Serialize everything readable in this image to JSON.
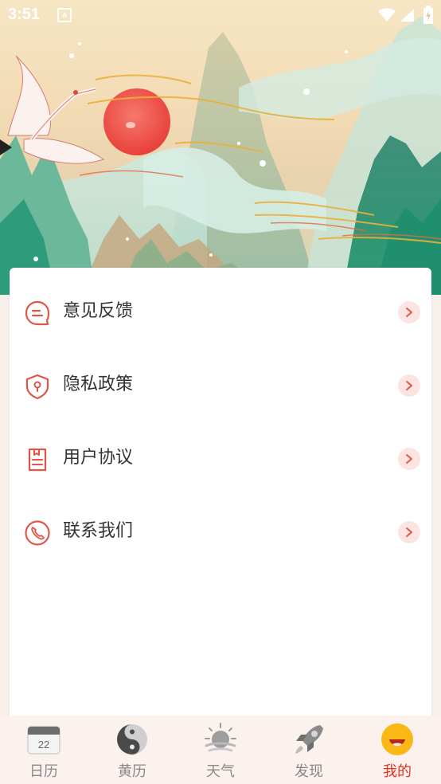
{
  "status_bar": {
    "time": "3:51",
    "notification_icon": "a-icon",
    "wifi_icon": "wifi-icon",
    "signal_icon": "signal-icon",
    "battery_icon": "battery-icon"
  },
  "hero": {
    "image": "landscape-with-crane-and-red-sun"
  },
  "menu": {
    "items": [
      {
        "label": "意见反馈",
        "icon": "feedback-icon"
      },
      {
        "label": "隐私政策",
        "icon": "privacy-shield-icon"
      },
      {
        "label": "用户协议",
        "icon": "agreement-document-icon"
      },
      {
        "label": "联系我们",
        "icon": "phone-icon"
      }
    ]
  },
  "tabbar": {
    "tabs": [
      {
        "label": "日历",
        "icon": "calendar-icon",
        "calendar_day": "22",
        "active": false
      },
      {
        "label": "黄历",
        "icon": "yin-yang-icon",
        "active": false
      },
      {
        "label": "天气",
        "icon": "weather-icon",
        "active": false
      },
      {
        "label": "发现",
        "icon": "rocket-icon",
        "active": false
      },
      {
        "label": "我的",
        "icon": "smiley-face-icon",
        "active": true
      }
    ]
  },
  "colors": {
    "accent": "#e3311f",
    "icon_red": "#e0574a",
    "arrow_bg": "#fbe4e2",
    "tab_inactive": "#888888",
    "label_text": "#333333"
  }
}
